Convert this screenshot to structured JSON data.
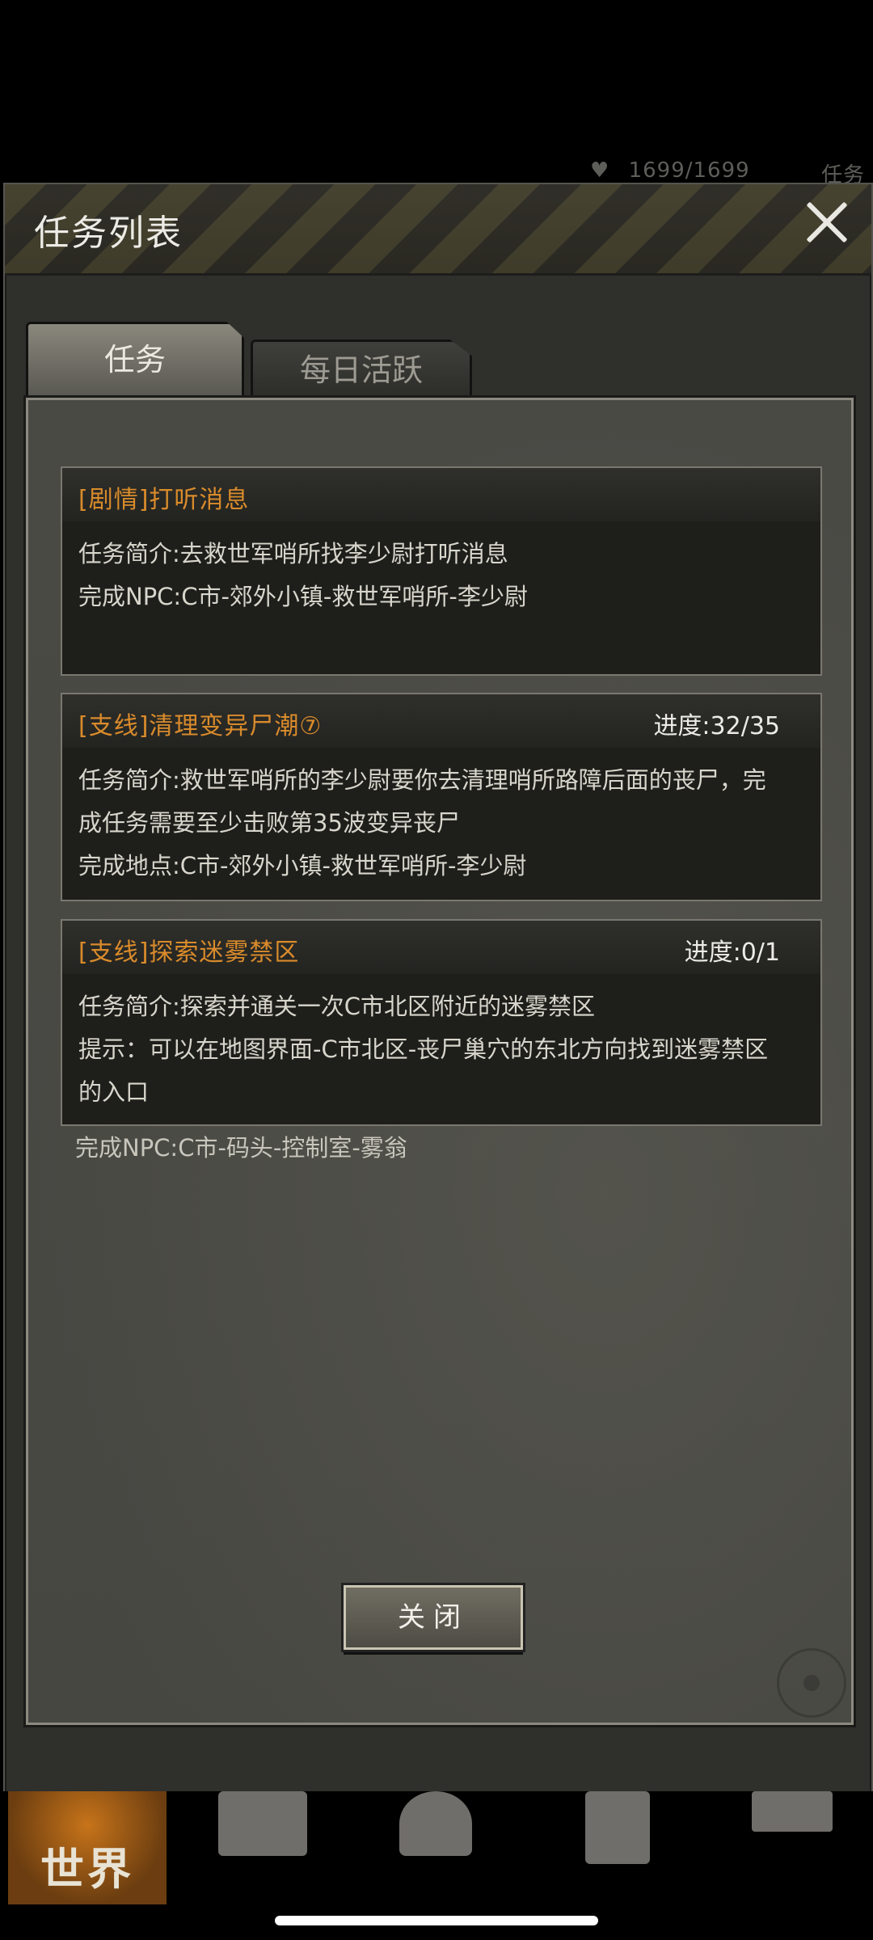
{
  "background_status": {
    "hp_text": "1699/1699",
    "task_label": "任务"
  },
  "modal": {
    "title": "任务列表",
    "tabs": [
      {
        "label": "任务",
        "active": true
      },
      {
        "label": "每日活跃",
        "active": false
      }
    ],
    "quests": [
      {
        "title": "[剧情]打听消息",
        "progress": "",
        "lines": [
          "任务简介:去救世军哨所找李少尉打听消息",
          "完成NPC:C市-郊外小镇-救世军哨所-李少尉"
        ]
      },
      {
        "title": "[支线]清理变异尸潮⑦",
        "progress": "进度:32/35",
        "lines": [
          "任务简介:救世军哨所的李少尉要你去清理哨所路障后面的丧尸，完",
          "成任务需要至少击败第35波变异丧尸",
          "完成地点:C市-郊外小镇-救世军哨所-李少尉"
        ]
      },
      {
        "title": "[支线]探索迷雾禁区",
        "progress": "进度:0/1",
        "lines": [
          "任务简介:探索并通关一次C市北区附近的迷雾禁区",
          "提示：可以在地图界面-C市北区-丧尸巢穴的东北方向找到迷雾禁区",
          "的入口"
        ]
      }
    ],
    "overflow_line": "完成NPC:C市-码头-控制室-雾翁",
    "close_button": "关闭"
  },
  "bottom_nav": {
    "world_label": "世界",
    "items": [
      "backpack-icon",
      "character-icon",
      "phone-icon",
      "shop-cart-icon"
    ]
  },
  "colors": {
    "quest_title": "#d98b2b",
    "accent_orange": "#c7741a"
  }
}
